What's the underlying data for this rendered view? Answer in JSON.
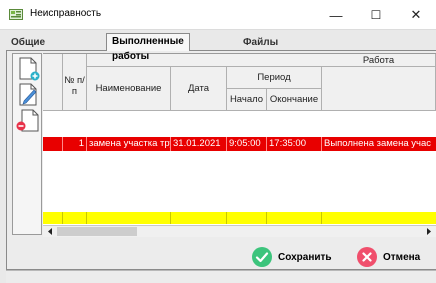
{
  "window": {
    "title": "Неисправность",
    "controls": {
      "minimize": "—",
      "maximize": "☐",
      "close": "✕"
    }
  },
  "tabs": [
    {
      "label": "Общие данные",
      "active": false
    },
    {
      "label": "Выполненные работы",
      "active": true
    },
    {
      "label": "Файлы",
      "active": false
    }
  ],
  "toolbar": {
    "buttons": [
      {
        "icon": "add-document-icon"
      },
      {
        "icon": "edit-document-icon"
      },
      {
        "icon": "delete-document-icon"
      }
    ]
  },
  "table": {
    "headers": {
      "num": "№ п/п",
      "name": "Наименование",
      "date": "Дата",
      "period": "Период",
      "start": "Начало",
      "end": "Окончание",
      "work": "Работа"
    },
    "rows": [
      {
        "num": "1",
        "name": "замена участка трубы",
        "date": "31.01.2021",
        "start": "9:05:00",
        "end": "17:35:00",
        "work": "Выполнена замена учас",
        "selected": true
      }
    ]
  },
  "footer": {
    "save_label": "Сохранить",
    "cancel_label": "Отмена"
  },
  "colors": {
    "selected_row": "#e80000",
    "summary_row": "#ffff00",
    "save_icon": "#3cc47c",
    "cancel_icon": "#f04f6c"
  }
}
